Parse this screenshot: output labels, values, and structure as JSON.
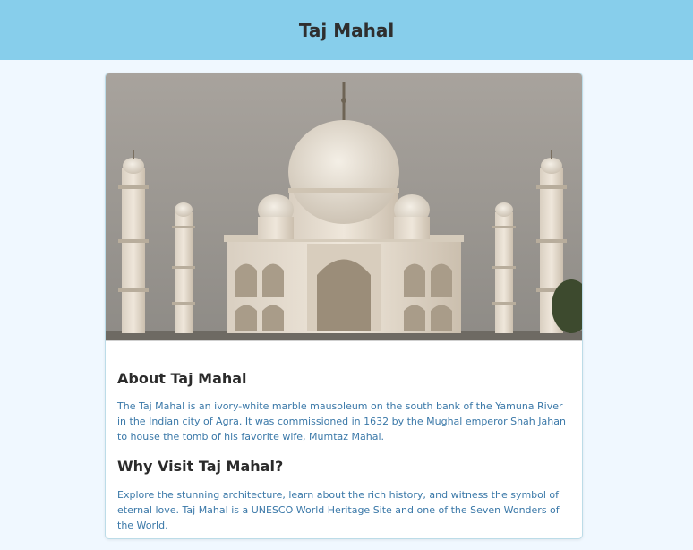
{
  "header": {
    "title": "Taj Mahal"
  },
  "card": {
    "image_alt": "Taj Mahal",
    "sections": [
      {
        "heading": "About Taj Mahal",
        "text": "The Taj Mahal is an ivory-white marble mausoleum on the south bank of the Yamuna River in the Indian city of Agra. It was commissioned in 1632 by the Mughal emperor Shah Jahan to house the tomb of his favorite wife, Mumtaz Mahal."
      },
      {
        "heading": "Why Visit Taj Mahal?",
        "text": "Explore the stunning architecture, learn about the rich history, and witness the symbol of eternal love. Taj Mahal is a UNESCO World Heritage Site and one of the Seven Wonders of the World."
      }
    ]
  },
  "colors": {
    "header_bg": "#87ceeb",
    "page_bg": "#f0f8ff",
    "body_text": "#3a78a8"
  }
}
